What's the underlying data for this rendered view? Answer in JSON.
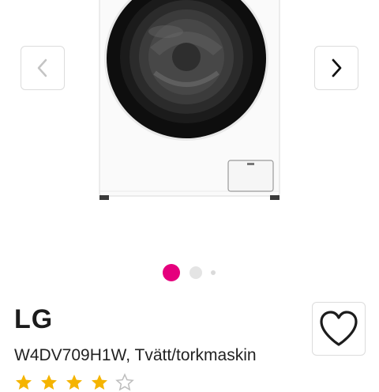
{
  "gallery": {
    "image_icon": "washing-machine-image",
    "prev_icon": "chevron-left-icon",
    "next_icon": "chevron-right-icon",
    "dots": [
      {
        "active": true,
        "color": "#e5007d"
      },
      {
        "active": false,
        "color": "#e4e4e4"
      },
      {
        "active": false,
        "color": "#dadada"
      }
    ]
  },
  "product": {
    "brand": "LG",
    "name": "W4DV709H1W, Tvätt/torkmaskin",
    "favorite_icon": "heart-outline-icon",
    "rating_icon": "star-icon",
    "rating": 4,
    "rating_max": 5,
    "star_color": "#f5b400"
  }
}
